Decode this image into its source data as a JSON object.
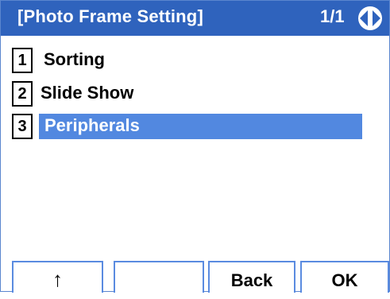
{
  "header": {
    "title": "[Photo Frame Setting]",
    "page_indicator": "1/1",
    "nav_icon": "left-right-arrows-icon"
  },
  "menu": {
    "items": [
      {
        "number": "1",
        "label": "Sorting",
        "selected": false
      },
      {
        "number": "2",
        "label": "Slide Show",
        "selected": false
      },
      {
        "number": "3",
        "label": "Peripherals",
        "selected": true
      }
    ]
  },
  "softkeys": {
    "key1": "↑",
    "key2": "",
    "key3": "Back",
    "key4": "OK"
  },
  "colors": {
    "titlebar": "#2f63bd",
    "selection": "#5288e0",
    "softkey_border": "#5a8be0"
  }
}
